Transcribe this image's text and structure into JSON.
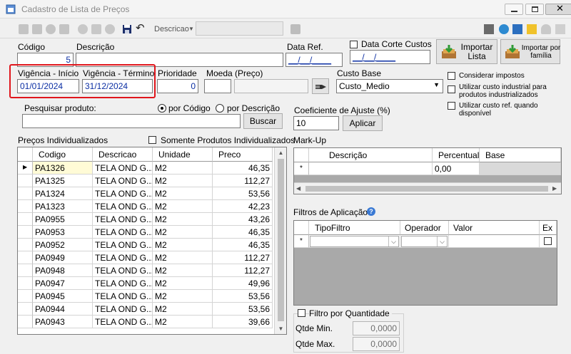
{
  "window": {
    "title": "Cadastro de Lista de Preços"
  },
  "toolbar": {
    "search_label": "Descricao",
    "search_value": ""
  },
  "form": {
    "codigo_label": "Código",
    "codigo_value": "5",
    "descricao_label": "Descrição",
    "descricao_value": "",
    "data_ref_label": "Data Ref.",
    "data_ref_value": "__/__/____",
    "data_corte_label": "Data Corte Custos",
    "data_corte_value": "__/__/____",
    "vigencia_inicio_label": "Vigência - Início",
    "vigencia_inicio_value": "01/01/2024",
    "vigencia_termino_label": "Vigência - Término",
    "vigencia_termino_value": "31/12/2024",
    "prioridade_label": "Prioridade",
    "prioridade_value": "0",
    "moeda_label": "Moeda (Preço)",
    "moeda_value": "",
    "custo_base_label": "Custo Base",
    "custo_base_value": "Custo_Medio",
    "importar_lista_label": "Importar Lista",
    "importar_familia_label": "Importar por família",
    "considerar_impostos_label": "Considerar impostos",
    "custo_industrial_label": "Utilizar custo industrial para produtos industrializados",
    "custo_ref_label": "Utilizar custo ref. quando disponível",
    "pesquisar_label": "Pesquisar produto:",
    "pesquisar_value": "",
    "radio_codigo_label": "por Código",
    "radio_descricao_label": "por Descrição",
    "buscar_label": "Buscar",
    "coef_label": "Coeficiente de Ajuste (%)",
    "coef_value": "10",
    "aplicar_label": "Aplicar"
  },
  "precos": {
    "title": "Preços Individualizados",
    "somente_label": "Somente Produtos Individualizados",
    "columns": [
      "Codigo",
      "Descricao",
      "Unidade",
      "Preco"
    ],
    "rows": [
      {
        "codigo": "PA1326",
        "descricao": "TELA OND G...",
        "unidade": "M2",
        "preco": "46,35"
      },
      {
        "codigo": "PA1325",
        "descricao": "TELA OND G...",
        "unidade": "M2",
        "preco": "112,27"
      },
      {
        "codigo": "PA1324",
        "descricao": "TELA OND G...",
        "unidade": "M2",
        "preco": "53,56"
      },
      {
        "codigo": "PA1323",
        "descricao": "TELA OND G...",
        "unidade": "M2",
        "preco": "42,23"
      },
      {
        "codigo": "PA0955",
        "descricao": "TELA OND G...",
        "unidade": "M2",
        "preco": "43,26"
      },
      {
        "codigo": "PA0953",
        "descricao": "TELA OND G...",
        "unidade": "M2",
        "preco": "46,35"
      },
      {
        "codigo": "PA0952",
        "descricao": "TELA OND G...",
        "unidade": "M2",
        "preco": "46,35"
      },
      {
        "codigo": "PA0949",
        "descricao": "TELA OND G...",
        "unidade": "M2",
        "preco": "112,27"
      },
      {
        "codigo": "PA0948",
        "descricao": "TELA OND G...",
        "unidade": "M2",
        "preco": "112,27"
      },
      {
        "codigo": "PA0947",
        "descricao": "TELA OND G...",
        "unidade": "M2",
        "preco": "49,96"
      },
      {
        "codigo": "PA0945",
        "descricao": "TELA OND G...",
        "unidade": "M2",
        "preco": "53,56"
      },
      {
        "codigo": "PA0944",
        "descricao": "TELA OND G...",
        "unidade": "M2",
        "preco": "53,56"
      },
      {
        "codigo": "PA0943",
        "descricao": "TELA OND G...",
        "unidade": "M2",
        "preco": "39,66"
      }
    ]
  },
  "markup": {
    "title": "Mark-Up",
    "columns": [
      "Descrição",
      "Percentual",
      "Base"
    ],
    "new_row_marker": "*",
    "new_row_percentual": "0,00"
  },
  "filtros": {
    "title": "Filtros de Aplicação",
    "columns": [
      "TipoFiltro",
      "Operador",
      "Valor",
      "Ex"
    ],
    "new_row_marker": "*"
  },
  "quantidade": {
    "title": "Filtro por Quantidade",
    "min_label": "Qtde Min.",
    "min_value": "0,0000",
    "max_label": "Qtde Max.",
    "max_value": "0,0000"
  },
  "colors": {
    "highlight_border": "#e0161c",
    "link_blue": "#0b2ea3",
    "selected_cell": "#fffbd6"
  },
  "icons": {
    "title": "app-window-icon",
    "importar_lista": "folder-import-icon",
    "importar_familia": "folder-import-icon",
    "moeda": "hand-pointer-icon",
    "help": "help-icon"
  }
}
